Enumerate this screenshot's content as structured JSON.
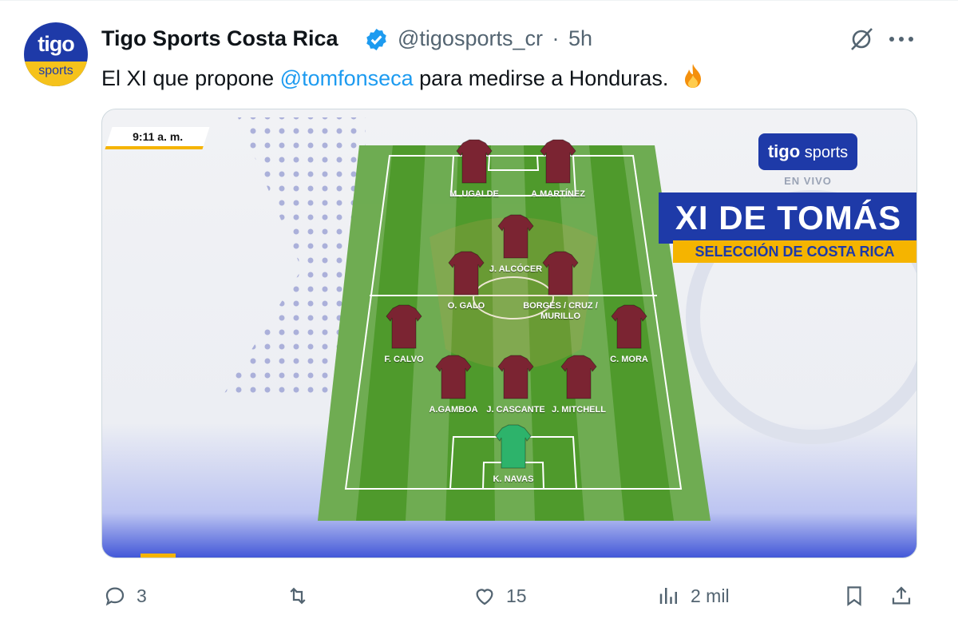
{
  "post": {
    "author_name": "Tigo Sports Costa Rica",
    "handle": "@tigosports_cr",
    "separator": "·",
    "time": "5h",
    "text_before": "El XI que propone ",
    "mention": "@tomfonseca",
    "text_after": " para medirse a Honduras.",
    "emoji": "fire-emoji",
    "avatar": {
      "top": "tigo",
      "bottom": "sports"
    }
  },
  "media": {
    "timestamp": "9:11 a. m.",
    "logo_tigo": "tigo",
    "logo_sports": "sports",
    "live_label": "EN VIVO",
    "title": "XI DE TOMÁS",
    "subtitle": "SELECCIÓN DE COSTA RICA",
    "players": [
      {
        "name": "M. UGALDE",
        "role": "forward"
      },
      {
        "name": "A.MARTÍNEZ",
        "role": "forward"
      },
      {
        "name": "J. ALCÓCER",
        "role": "midfielder"
      },
      {
        "name": "O. GALO",
        "role": "midfielder"
      },
      {
        "name": "BORGES / CRUZ /",
        "name2": "MURILLO",
        "role": "midfielder"
      },
      {
        "name": "F. CALVO",
        "role": "defender"
      },
      {
        "name": "C. MORA",
        "role": "defender"
      },
      {
        "name": "A.GAMBOA",
        "role": "defender"
      },
      {
        "name": "J. CASCANTE",
        "role": "defender"
      },
      {
        "name": "J. MITCHELL",
        "role": "defender"
      },
      {
        "name": "K. NAVAS",
        "role": "goalkeeper"
      }
    ],
    "colors": {
      "brand_blue": "#1e3aa8",
      "accent_yellow": "#f5b400",
      "jersey": "#7b2432",
      "gk_jersey": "#2db36b",
      "pitch": "#4f9a2c"
    }
  },
  "actions": {
    "replies": "3",
    "retweets": "",
    "likes": "15",
    "views": "2 mil"
  }
}
